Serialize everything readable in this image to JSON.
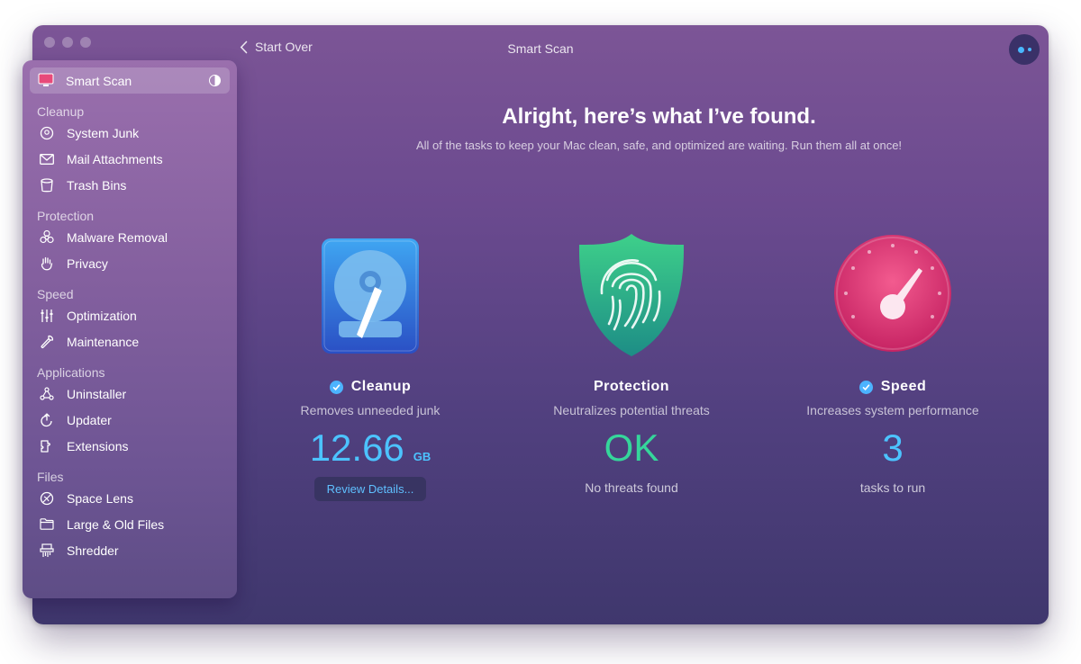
{
  "window": {
    "title": "Smart Scan",
    "back_label": "Start Over"
  },
  "sidebar": {
    "active": {
      "label": "Smart Scan",
      "icon": "monitor-icon"
    },
    "sections": [
      {
        "title": "Cleanup",
        "items": [
          {
            "label": "System Junk",
            "icon": "system-junk-icon"
          },
          {
            "label": "Mail Attachments",
            "icon": "mail-icon"
          },
          {
            "label": "Trash Bins",
            "icon": "trash-icon"
          }
        ]
      },
      {
        "title": "Protection",
        "items": [
          {
            "label": "Malware Removal",
            "icon": "biohazard-icon"
          },
          {
            "label": "Privacy",
            "icon": "hand-icon"
          }
        ]
      },
      {
        "title": "Speed",
        "items": [
          {
            "label": "Optimization",
            "icon": "sliders-icon"
          },
          {
            "label": "Maintenance",
            "icon": "wrench-icon"
          }
        ]
      },
      {
        "title": "Applications",
        "items": [
          {
            "label": "Uninstaller",
            "icon": "uninstaller-icon"
          },
          {
            "label": "Updater",
            "icon": "updater-icon"
          },
          {
            "label": "Extensions",
            "icon": "extensions-icon"
          }
        ]
      },
      {
        "title": "Files",
        "items": [
          {
            "label": "Space Lens",
            "icon": "space-lens-icon"
          },
          {
            "label": "Large & Old Files",
            "icon": "folder-icon"
          },
          {
            "label": "Shredder",
            "icon": "shredder-icon"
          }
        ]
      }
    ]
  },
  "main": {
    "heading": "Alright, here’s what I’ve found.",
    "subheading": "All of the tasks to keep your Mac clean, safe, and optimized are waiting. Run them all at once!"
  },
  "cards": {
    "cleanup": {
      "name": "Cleanup",
      "checked": true,
      "description": "Removes unneeded junk",
      "value": "12.66",
      "unit": "GB",
      "button": "Review Details...",
      "value_color": "#4cc3ff"
    },
    "protection": {
      "name": "Protection",
      "checked": false,
      "description": "Neutralizes potential threats",
      "value": "OK",
      "footer": "No threats found",
      "value_color": "#35d69b"
    },
    "speed": {
      "name": "Speed",
      "checked": true,
      "description": "Increases system performance",
      "value": "3",
      "footer": "tasks to run",
      "value_color": "#4cc3ff"
    }
  },
  "colors": {
    "accent": "#4cb3ff",
    "window_top": "#7c5596",
    "window_bottom": "#3f376d"
  }
}
